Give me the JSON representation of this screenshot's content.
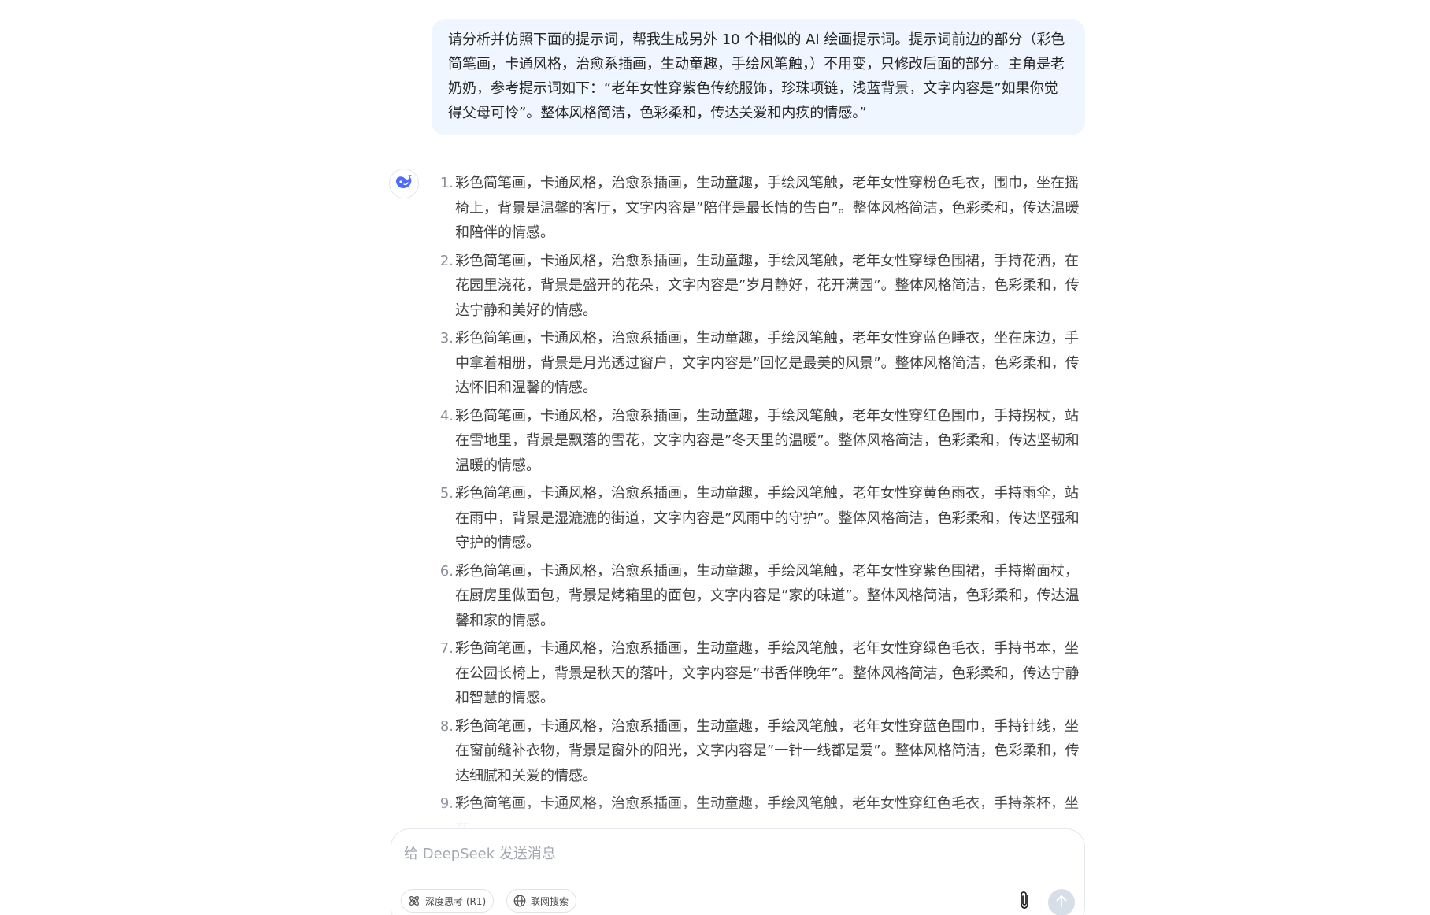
{
  "conversation": {
    "user_message": "请分析并仿照下面的提示词，帮我生成另外 10 个相似的 AI 绘画提示词。提示词前边的部分（彩色简笔画，卡通风格，治愈系插画，生动童趣，手绘风笔触，）不用变，只修改后面的部分。主角是老奶奶，参考提示词如下：“老年女性穿紫色传统服饰，珍珠项链，浅蓝背景，文字内容是”如果你觉得父母可怜”。整体风格简洁，色彩柔和，传达关爱和内疚的情感。”",
    "assistant_avatar_icon": "deepseek-whale-icon",
    "answer_items": [
      {
        "num": "1.",
        "text": "彩色简笔画，卡通风格，治愈系插画，生动童趣，手绘风笔触，老年女性穿粉色毛衣，围巾，坐在摇椅上，背景是温馨的客厅，文字内容是”陪伴是最长情的告白”。整体风格简洁，色彩柔和，传达温暖和陪伴的情感。"
      },
      {
        "num": "2.",
        "text": "彩色简笔画，卡通风格，治愈系插画，生动童趣，手绘风笔触，老年女性穿绿色围裙，手持花洒，在花园里浇花，背景是盛开的花朵，文字内容是”岁月静好，花开满园”。整体风格简洁，色彩柔和，传达宁静和美好的情感。"
      },
      {
        "num": "3.",
        "text": "彩色简笔画，卡通风格，治愈系插画，生动童趣，手绘风笔触，老年女性穿蓝色睡衣，坐在床边，手中拿着相册，背景是月光透过窗户，文字内容是”回忆是最美的风景”。整体风格简洁，色彩柔和，传达怀旧和温馨的情感。"
      },
      {
        "num": "4.",
        "text": "彩色简笔画，卡通风格，治愈系插画，生动童趣，手绘风笔触，老年女性穿红色围巾，手持拐杖，站在雪地里，背景是飘落的雪花，文字内容是”冬天里的温暖”。整体风格简洁，色彩柔和，传达坚韧和温暖的情感。"
      },
      {
        "num": "5.",
        "text": "彩色简笔画，卡通风格，治愈系插画，生动童趣，手绘风笔触，老年女性穿黄色雨衣，手持雨伞，站在雨中，背景是湿漉漉的街道，文字内容是”风雨中的守护”。整体风格简洁，色彩柔和，传达坚强和守护的情感。"
      },
      {
        "num": "6.",
        "text": "彩色简笔画，卡通风格，治愈系插画，生动童趣，手绘风笔触，老年女性穿紫色围裙，手持擀面杖，在厨房里做面包，背景是烤箱里的面包，文字内容是”家的味道”。整体风格简洁，色彩柔和，传达温馨和家的情感。"
      },
      {
        "num": "7.",
        "text": "彩色简笔画，卡通风格，治愈系插画，生动童趣，手绘风笔触，老年女性穿绿色毛衣，手持书本，坐在公园长椅上，背景是秋天的落叶，文字内容是”书香伴晚年”。整体风格简洁，色彩柔和，传达宁静和智慧的情感。"
      },
      {
        "num": "8.",
        "text": "彩色简笔画，卡通风格，治愈系插画，生动童趣，手绘风笔触，老年女性穿蓝色围巾，手持针线，坐在窗前缝补衣物，背景是窗外的阳光，文字内容是”一针一线都是爱”。整体风格简洁，色彩柔和，传达细腻和关爱的情感。"
      },
      {
        "num": "9.",
        "text": "彩色简笔画，卡通风格，治愈系插画，生动童趣，手绘风笔触，老年女性穿红色毛衣，手持茶杯，坐在"
      }
    ]
  },
  "composer": {
    "placeholder": "给 DeepSeek 发送消息",
    "value": "",
    "deep_think_label": "深度思考 (R1)",
    "deep_think_icon": "atom-icon",
    "web_search_label": "联网搜索",
    "web_search_icon": "globe-icon",
    "attach_icon": "paperclip-icon",
    "send_icon": "arrow-up-icon"
  },
  "colors": {
    "user_bubble_bg": "#eff6ff",
    "brand_blue": "#4d6bfe",
    "send_disabled_bg": "#d6dee8"
  }
}
